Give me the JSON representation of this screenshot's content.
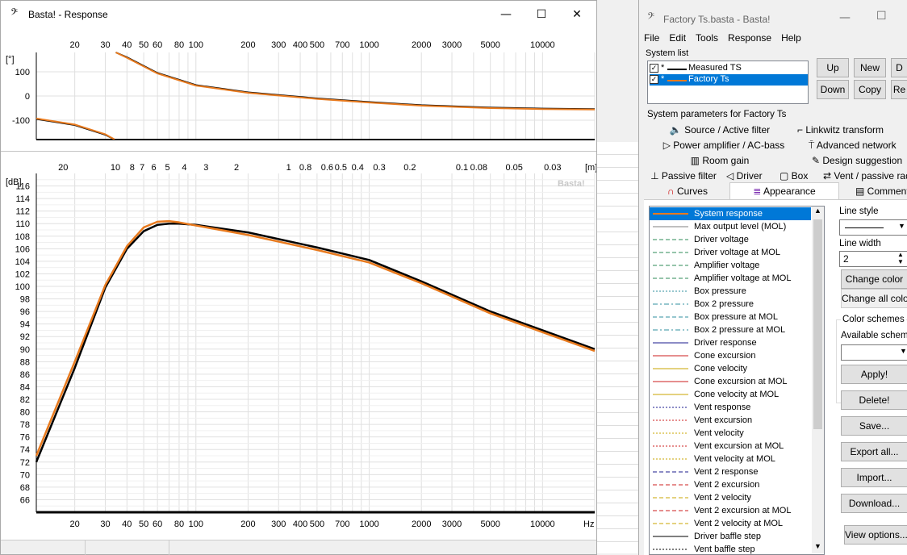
{
  "response_window": {
    "title": "Basta! - Response",
    "icon": "bass-clef-icon",
    "controls": {
      "minimize": "—",
      "maximize": "☐",
      "close": "✕"
    },
    "phase_plot": {
      "unit_label": "[°]",
      "y_ticks": [
        "100",
        "0",
        "-100"
      ],
      "x_ticks": [
        "20",
        "30",
        "40",
        "50",
        "60",
        "80",
        "100",
        "200",
        "300",
        "400",
        "500",
        "700",
        "1000",
        "2000",
        "3000",
        "5000",
        "10000"
      ]
    },
    "spl_plot": {
      "unit_label": "[dB]",
      "watermark": "Basta!",
      "wavelength_unit": "[m]",
      "wavelength_ticks": [
        "20",
        "10",
        "8",
        "7",
        "6",
        "5",
        "4",
        "3",
        "2",
        "1",
        "0.8",
        "0.6",
        "0.5",
        "0.4",
        "0.3",
        "0.2",
        "0.1",
        "0.08",
        "0.05",
        "0.03"
      ],
      "y_ticks": [
        "116",
        "114",
        "112",
        "110",
        "108",
        "106",
        "104",
        "102",
        "100",
        "98",
        "96",
        "94",
        "92",
        "90",
        "88",
        "86",
        "84",
        "82",
        "80",
        "78",
        "76",
        "74",
        "72",
        "70",
        "68",
        "66"
      ],
      "x_ticks": [
        "20",
        "30",
        "40",
        "50",
        "60",
        "80",
        "100",
        "200",
        "300",
        "400",
        "500",
        "700",
        "1000",
        "2000",
        "3000",
        "5000",
        "10000"
      ],
      "x_unit": "Hz"
    }
  },
  "chart_data": [
    {
      "type": "line",
      "title": "",
      "xlabel": "",
      "ylabel": "[°]",
      "x_scale": "log",
      "xlim": [
        12,
        20000
      ],
      "ylim": [
        -180,
        180
      ],
      "series": [
        {
          "name": "Measured TS",
          "color": "#000000",
          "x": [
            12,
            20,
            30,
            34,
            34.5,
            40,
            60,
            100,
            200,
            500,
            1000,
            2000,
            5000,
            10000,
            20000
          ],
          "y": [
            -95,
            -120,
            -160,
            -180,
            180,
            160,
            95,
            45,
            15,
            -10,
            -25,
            -38,
            -48,
            -52,
            -54
          ]
        },
        {
          "name": "Factory Ts",
          "color": "#e87a1e",
          "x": [
            12,
            20,
            30,
            34,
            34.5,
            40,
            60,
            100,
            200,
            500,
            1000,
            2000,
            5000,
            10000,
            20000
          ],
          "y": [
            -93,
            -118,
            -158,
            -180,
            180,
            158,
            93,
            43,
            13,
            -12,
            -27,
            -40,
            -50,
            -54,
            -56
          ]
        }
      ]
    },
    {
      "type": "line",
      "title": "",
      "xlabel": "Hz",
      "ylabel": "[dB]",
      "x_scale": "log",
      "xlim": [
        12,
        20000
      ],
      "ylim": [
        64,
        118
      ],
      "series": [
        {
          "name": "Measured TS",
          "color": "#000000",
          "x": [
            12,
            20,
            30,
            40,
            50,
            60,
            70,
            80,
            100,
            200,
            500,
            1000,
            2000,
            5000,
            10000,
            20000
          ],
          "y": [
            72,
            87,
            99.8,
            106,
            108.8,
            109.8,
            110,
            110,
            109.8,
            108.6,
            106.2,
            104.2,
            100.8,
            96,
            93,
            90
          ]
        },
        {
          "name": "Factory Ts",
          "color": "#e87a1e",
          "x": [
            12,
            20,
            30,
            40,
            50,
            60,
            70,
            80,
            100,
            200,
            500,
            1000,
            2000,
            5000,
            10000,
            20000
          ],
          "y": [
            73,
            88,
            100.2,
            106.4,
            109.4,
            110.3,
            110.4,
            110.2,
            109.7,
            108.2,
            105.8,
            103.8,
            100.5,
            95.7,
            92.7,
            89.7
          ]
        }
      ]
    }
  ],
  "factory_window": {
    "title": "Factory Ts.basta - Basta!",
    "icon": "bass-clef-icon",
    "controls": {
      "minimize": "—",
      "maximize": "☐"
    },
    "menu": [
      "File",
      "Edit",
      "Tools",
      "Response",
      "Help"
    ],
    "system_list_label": "System list",
    "systems": [
      {
        "label": "Measured TS",
        "checked": true,
        "marker": "*",
        "color": "#000000"
      },
      {
        "label": "Factory Ts",
        "checked": true,
        "marker": "*",
        "color": "#e87a1e"
      }
    ],
    "list_buttons": {
      "up": "Up",
      "down": "Down",
      "new": "New",
      "copy": "Copy",
      "d": "D",
      "re": "Re"
    },
    "params_label": "System parameters for Factory Ts",
    "tabs": [
      {
        "label": "Source / Active filter",
        "icon": "speaker-icon"
      },
      {
        "label": "Linkwitz transform",
        "icon": "filter-curve-icon"
      },
      {
        "label": "Power amplifier / AC-bass",
        "icon": "amplifier-icon"
      },
      {
        "label": "Advanced network",
        "icon": "network-icon"
      },
      {
        "label": "Room gain",
        "icon": "room-icon"
      },
      {
        "label": "Design suggestion",
        "icon": "pencil-icon"
      },
      {
        "label": "Passive filter",
        "icon": "passive-filter-icon"
      },
      {
        "label": "Driver",
        "icon": "driver-icon"
      },
      {
        "label": "Box",
        "icon": "box-icon"
      },
      {
        "label": "Vent / passive radiator",
        "icon": "vent-icon"
      },
      {
        "label": "Curves",
        "icon": "curves-icon"
      },
      {
        "label": "Appearance",
        "icon": "appearance-icon"
      },
      {
        "label": "Comments",
        "icon": "comments-icon"
      }
    ],
    "curves": [
      {
        "label": "System response",
        "color": "#e87a1e",
        "dash": "solid",
        "selected": true
      },
      {
        "label": "Max output level (MOL)",
        "color": "#7f7f7f",
        "dash": "solid"
      },
      {
        "label": "Driver voltage",
        "color": "#2e8b57",
        "dash": "dash"
      },
      {
        "label": "Driver voltage at MOL",
        "color": "#2e8b57",
        "dash": "dash"
      },
      {
        "label": "Amplifier voltage",
        "color": "#2e8b57",
        "dash": "dash"
      },
      {
        "label": "Amplifier voltage at MOL",
        "color": "#2e8b57",
        "dash": "dash"
      },
      {
        "label": "Box pressure",
        "color": "#2f8f9f",
        "dash": "dot"
      },
      {
        "label": "Box 2 pressure",
        "color": "#2f8f9f",
        "dash": "dashdot"
      },
      {
        "label": "Box pressure at MOL",
        "color": "#2f8f9f",
        "dash": "dash"
      },
      {
        "label": "Box 2 pressure at MOL",
        "color": "#2f8f9f",
        "dash": "dashdot"
      },
      {
        "label": "Driver response",
        "color": "#1a1a8c",
        "dash": "solid"
      },
      {
        "label": "Cone excursion",
        "color": "#cc1f1f",
        "dash": "solid"
      },
      {
        "label": "Cone velocity",
        "color": "#c9a400",
        "dash": "solid"
      },
      {
        "label": "Cone excursion at MOL",
        "color": "#cc1f1f",
        "dash": "solid"
      },
      {
        "label": "Cone velocity at MOL",
        "color": "#c9a400",
        "dash": "solid"
      },
      {
        "label": "Vent response",
        "color": "#1a1a8c",
        "dash": "dot"
      },
      {
        "label": "Vent excursion",
        "color": "#cc1f1f",
        "dash": "dot"
      },
      {
        "label": "Vent velocity",
        "color": "#c9a400",
        "dash": "dot"
      },
      {
        "label": "Vent excursion at MOL",
        "color": "#cc1f1f",
        "dash": "dot"
      },
      {
        "label": "Vent velocity at MOL",
        "color": "#c9a400",
        "dash": "dot"
      },
      {
        "label": "Vent 2 response",
        "color": "#1a1a8c",
        "dash": "dash"
      },
      {
        "label": "Vent 2 excursion",
        "color": "#cc1f1f",
        "dash": "dash"
      },
      {
        "label": "Vent 2 velocity",
        "color": "#c9a400",
        "dash": "dash"
      },
      {
        "label": "Vent 2 excursion at MOL",
        "color": "#cc1f1f",
        "dash": "dash"
      },
      {
        "label": "Vent 2 velocity at MOL",
        "color": "#c9a400",
        "dash": "dash"
      },
      {
        "label": "Driver baffle step",
        "color": "#000000",
        "dash": "solid"
      },
      {
        "label": "Vent baffle step",
        "color": "#000000",
        "dash": "dot"
      }
    ],
    "line_style_label": "Line style",
    "line_width_label": "Line width",
    "line_width_value": "2",
    "change_color": "Change color",
    "change_all_colors": "Change all colors",
    "color_schemes_label": "Color schemes",
    "available_schemes_label": "Available schemes",
    "apply": "Apply!",
    "delete": "Delete!",
    "save": "Save...",
    "export_all": "Export all...",
    "import": "Import...",
    "download": "Download...",
    "view_options": "View options..."
  }
}
